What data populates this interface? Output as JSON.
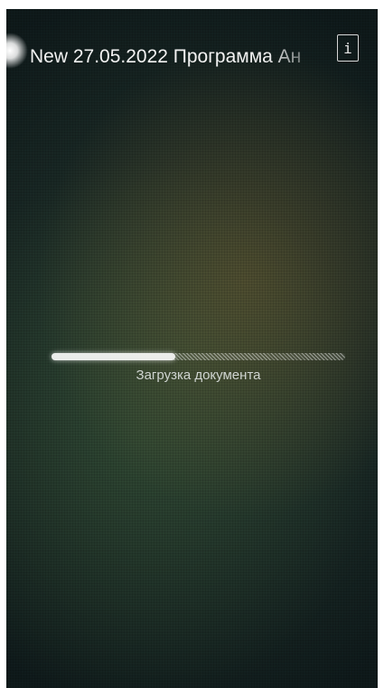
{
  "header": {
    "title": "New 27.05.2022 Программа Ан",
    "info_icon": "info-icon",
    "info_glyph": "i"
  },
  "loader": {
    "progress": 0.42,
    "label": "Загрузка документа"
  },
  "colors": {
    "text": "#f2f2f2",
    "progress_fill": "#ffffff",
    "background_dark": "#0f1a1b"
  }
}
